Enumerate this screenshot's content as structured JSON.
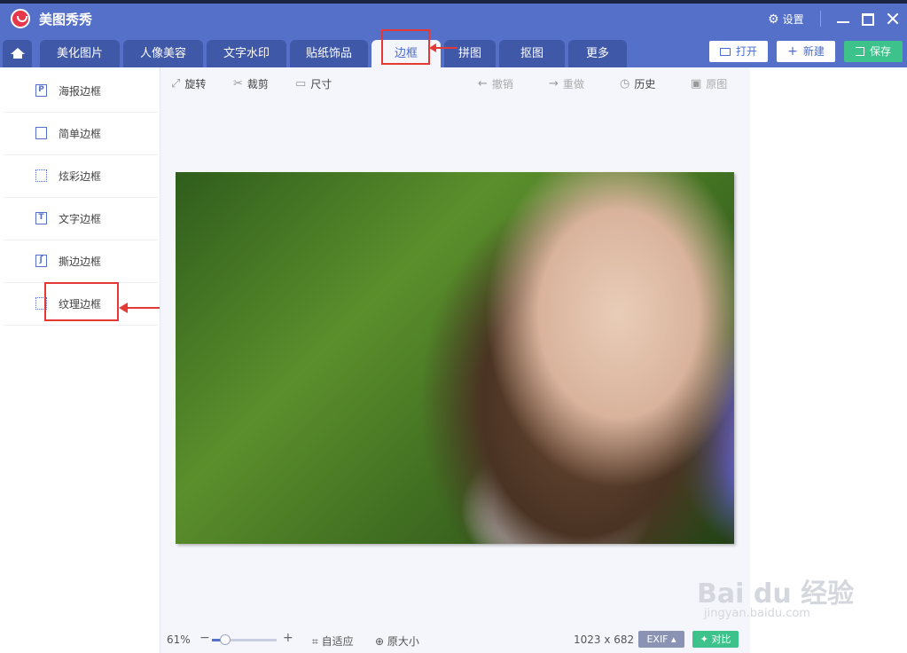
{
  "app": {
    "title": "美图秀秀"
  },
  "window": {
    "settings_label": "设置"
  },
  "tabs": [
    "美化图片",
    "人像美容",
    "文字水印",
    "贴纸饰品",
    "边框",
    "拼图",
    "抠图",
    "更多"
  ],
  "actions": {
    "open": "打开",
    "new": "新建",
    "save": "保存"
  },
  "sidebar": {
    "items": [
      {
        "label": "海报边框",
        "icon": "poster-frame-icon"
      },
      {
        "label": "简单边框",
        "icon": "simple-frame-icon"
      },
      {
        "label": "炫彩边框",
        "icon": "colorful-frame-icon"
      },
      {
        "label": "文字边框",
        "icon": "text-frame-icon"
      },
      {
        "label": "撕边边框",
        "icon": "torn-edge-frame-icon"
      },
      {
        "label": "纹理边框",
        "icon": "texture-frame-icon"
      }
    ]
  },
  "toolbar": {
    "rotate": "旋转",
    "crop": "裁剪",
    "size": "尺寸",
    "undo": "撤销",
    "redo": "重做",
    "history": "历史",
    "original": "原图"
  },
  "status": {
    "zoom": "61%",
    "zoom_level": 0.2,
    "fit": "自适应",
    "actual_size": "原大小",
    "dimensions": "1023 x 682",
    "exif": "EXIF",
    "compare": "对比"
  },
  "watermark": {
    "main": "Bai du 经验",
    "sub": "jingyan.baidu.com"
  },
  "colors": {
    "accent": "#5570c9",
    "save_green": "#3cc28a",
    "highlight_red": "#e53935"
  }
}
